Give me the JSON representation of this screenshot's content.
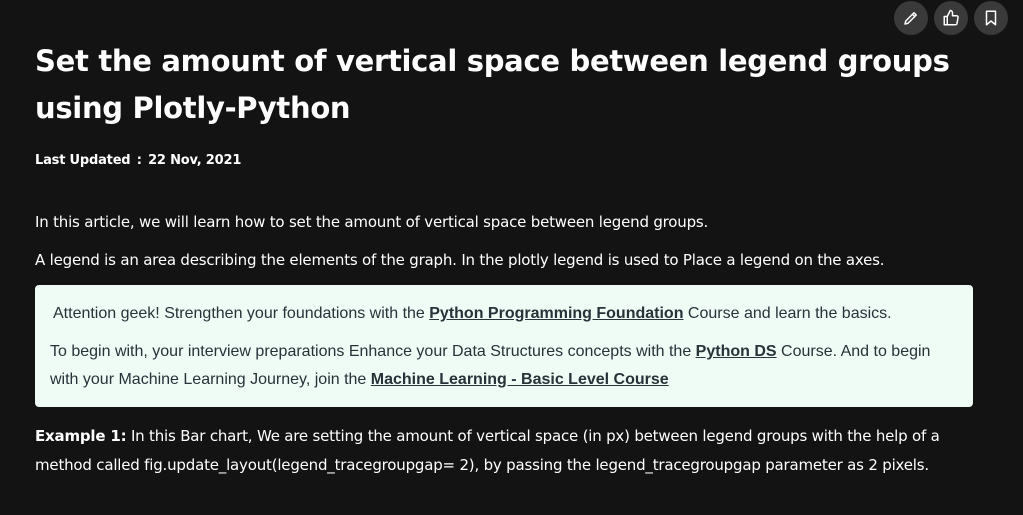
{
  "actions": {
    "edit_icon": "pencil-icon",
    "like_icon": "thumbs-up-icon",
    "bookmark_icon": "bookmark-icon"
  },
  "article": {
    "title": "Set the amount of vertical space between legend groups using Plotly-Python",
    "updated_label": "Last Updated",
    "updated_sep": ":",
    "updated_date": "22 Nov, 2021",
    "intro": "In this article, we will learn how to set the amount of vertical space between legend groups.",
    "legend_desc": "A legend is an area describing the elements of the graph. In the plotly legend is used to Place a legend on the axes.",
    "callout": {
      "line1_before": "Attention geek! Strengthen your foundations with the ",
      "line1_link": "Python Programming Foundation",
      "line1_after": " Course and learn the basics.",
      "line2_before": "To begin with, your interview preparations Enhance your Data Structures concepts with the ",
      "line2_link1": "Python DS",
      "line2_mid": " Course. And to begin with your Machine Learning Journey, join the ",
      "line2_link2": "Machine Learning - Basic Level Course"
    },
    "example_label": "Example 1:",
    "example_text": " In this Bar chart, We are setting the amount of vertical space (in px) between legend groups with the help of a method called fig.update_layout(legend_tracegroupgap= 2), by passing the legend_tracegroupgap parameter as 2 pixels."
  },
  "colors": {
    "background": "#131313",
    "text": "#ffffff",
    "callout_bg": "#effbf5",
    "callout_text": "#273239",
    "icon_button_bg": "#3a3a3a"
  }
}
